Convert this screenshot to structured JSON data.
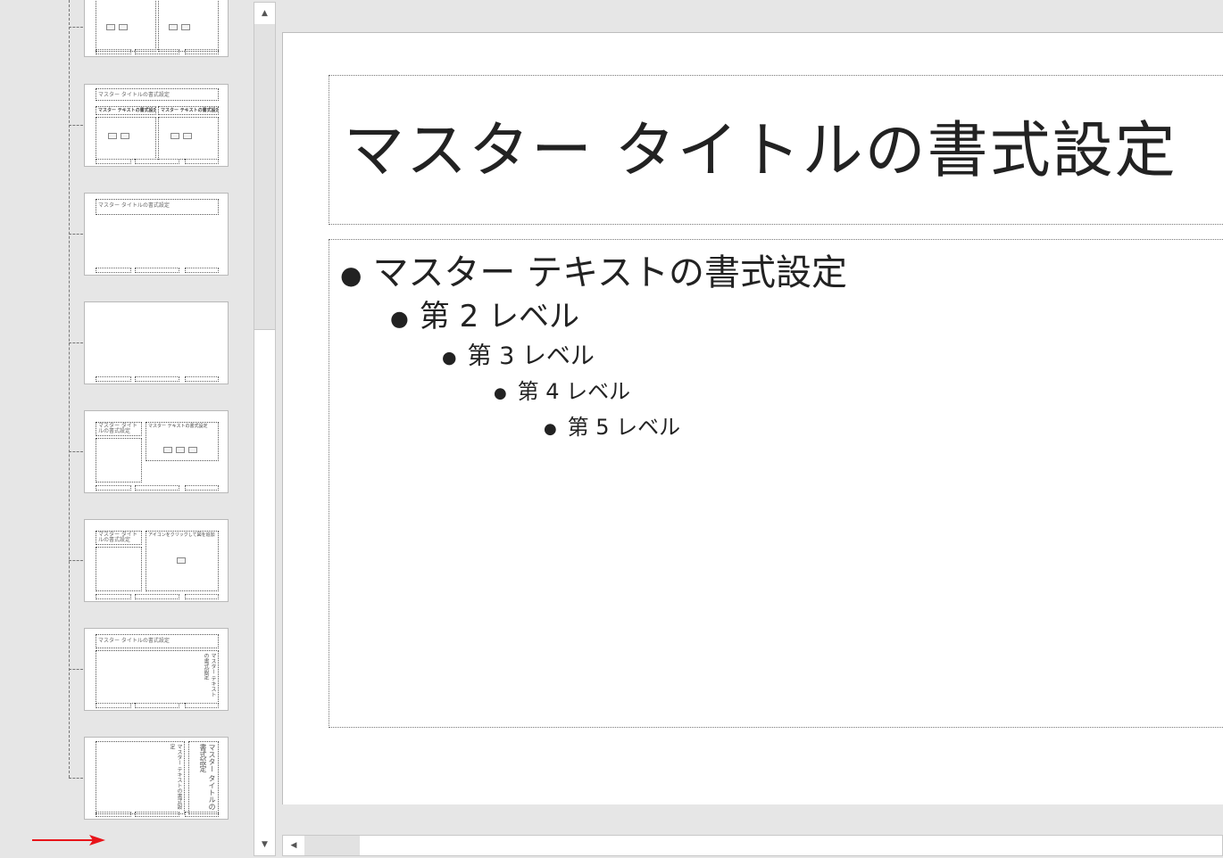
{
  "slide": {
    "title": "マスター タイトルの書式設定",
    "levels": [
      "マスター テキストの書式設定",
      "第 2 レベル",
      "第 3 レベル",
      "第 4 レベル",
      "第 5 レベル"
    ]
  },
  "thumbnails": {
    "t2": {
      "title": "マスター タイトルの書式設定",
      "left_heading": "マスター テキストの書式設定",
      "right_heading": "マスター テキストの書式設定"
    },
    "t3": {
      "title": "マスター タイトルの書式設定"
    },
    "t5": {
      "title": "マスター タイトルの書式設定",
      "body": "マスター テキストの書式設定"
    },
    "t6": {
      "title": "マスター タイトルの書式設定",
      "body": "アイコンをクリックして図を追加"
    },
    "t7": {
      "title": "マスター タイトルの書式設定",
      "body": "マスター テキストの書式設定"
    },
    "t8": {
      "title": "マスター タイトルの書式設定",
      "body": "マスター テキストの書式設定"
    }
  },
  "scroll": {
    "up_arrow": "▲",
    "down_arrow": "▼",
    "left_arrow": "◀"
  },
  "colors": {
    "arrow": "#e8141a",
    "pane_bg": "#e6e6e6",
    "slide_bg": "#ffffff"
  },
  "icons": [
    "up-arrow-icon",
    "down-arrow-icon",
    "left-arrow-icon",
    "red-arrow-icon"
  ]
}
